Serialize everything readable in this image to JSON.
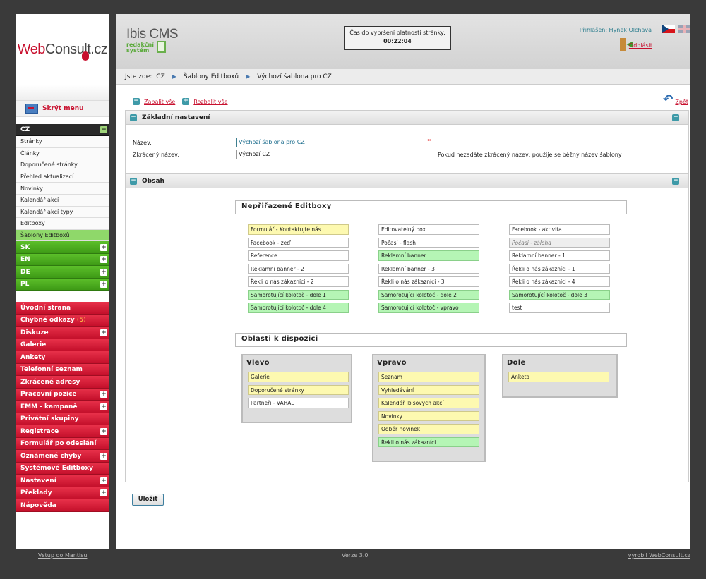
{
  "brand": {
    "logo_web": "Web",
    "logo_consult": "Consult.cz",
    "cms_title": "Ibis CMS",
    "cms_sub1": "redakční",
    "cms_sub2": "systém"
  },
  "sidebar": {
    "hide_menu": "Skrýt menu",
    "cz_label": "CZ",
    "cz_items": [
      "Stránky",
      "Články",
      "Doporučené stránky",
      "Přehled aktualizací",
      "Novinky",
      "Kalendář akcí",
      "Kalendář akcí typy",
      "Editboxy",
      "Šablony Editboxů"
    ],
    "langs": [
      "SK",
      "EN",
      "DE",
      "PL"
    ],
    "red_items": [
      {
        "label": "Úvodní strana",
        "plus": false
      },
      {
        "label": "Chybné odkazy",
        "badge": "(5)",
        "plus": false
      },
      {
        "label": "Diskuze",
        "plus": true
      },
      {
        "label": "Galerie",
        "plus": false
      },
      {
        "label": "Ankety",
        "plus": false
      },
      {
        "label": "Telefonní seznam",
        "plus": false
      },
      {
        "label": "Zkrácené adresy",
        "plus": false
      },
      {
        "label": "Pracovní pozice",
        "plus": true
      },
      {
        "label": "EMM - kampaně",
        "plus": true
      },
      {
        "label": "Privátní skupiny",
        "plus": false
      },
      {
        "label": "Registrace",
        "plus": true
      },
      {
        "label": "Formulář po odeslání",
        "plus": false
      },
      {
        "label": "Oznámené chyby",
        "plus": true
      },
      {
        "label": "Systémové Editboxy",
        "plus": false
      },
      {
        "label": "Nastavení",
        "plus": true
      },
      {
        "label": "Překlady",
        "plus": true
      },
      {
        "label": "Nápověda",
        "plus": false
      }
    ]
  },
  "header": {
    "timer_label": "Čas do vypršení platnosti stránky:",
    "timer_value": "00:22:04",
    "user": "Přihlášen: Hynek Olchava",
    "logout": "Odhlásit"
  },
  "breadcrumb": {
    "prefix": "Jste zde:",
    "items": [
      "CZ",
      "Šablony Editboxů",
      "Výchozí šablona pro CZ"
    ]
  },
  "toolbar": {
    "collapse_all": "Zabalit vše",
    "expand_all": "Rozbalit vše",
    "back": "Zpět"
  },
  "basic": {
    "title": "Základní nastavení",
    "name_label": "Název:",
    "name_value": "Výchozí šablona pro CZ",
    "short_label": "Zkrácený název:",
    "short_value": "Výchozí CZ",
    "short_hint": "Pokud nezadáte zkrácený název, použije se běžný název šablony"
  },
  "content": {
    "title": "Obsah",
    "unassigned_title": "Nepřiřazené Editboxy",
    "unassigned": [
      [
        {
          "t": "Formulář - Kontaktujte nás",
          "c": "y"
        },
        {
          "t": "Facebook - zeď",
          "c": ""
        },
        {
          "t": "Reference",
          "c": ""
        },
        {
          "t": "Reklamní banner - 2",
          "c": ""
        },
        {
          "t": "Řekli o nás zákazníci - 2",
          "c": ""
        },
        {
          "t": "Samorotující kolotoč - dole 1",
          "c": "g"
        },
        {
          "t": "Samorotující kolotoč - dole 4",
          "c": "g"
        }
      ],
      [
        {
          "t": "Editovatelný box",
          "c": ""
        },
        {
          "t": "Počasí - flash",
          "c": ""
        },
        {
          "t": "Reklamní banner",
          "c": "g"
        },
        {
          "t": "Reklamní banner - 3",
          "c": ""
        },
        {
          "t": "Řekli o nás zákazníci - 3",
          "c": ""
        },
        {
          "t": "Samorotující kolotoč - dole 2",
          "c": "g"
        },
        {
          "t": "Samorotující kolotoč - vpravo",
          "c": "g"
        }
      ],
      [
        {
          "t": "Facebook - aktivita",
          "c": ""
        },
        {
          "t": "Počasí - záloha",
          "c": "i"
        },
        {
          "t": "Reklamní banner - 1",
          "c": ""
        },
        {
          "t": "Řekli o nás zákazníci - 1",
          "c": ""
        },
        {
          "t": "Řekli o nás zákazníci - 4",
          "c": ""
        },
        {
          "t": "Samorotující kolotoč - dole 3",
          "c": "g"
        },
        {
          "t": "test",
          "c": ""
        }
      ]
    ],
    "areas_title": "Oblasti k dispozici",
    "areas": [
      {
        "name": "Vlevo",
        "items": [
          {
            "t": "Galerie",
            "c": "y"
          },
          {
            "t": "Doporučené stránky",
            "c": "y"
          },
          {
            "t": "Partneři - VAHAL",
            "c": ""
          }
        ]
      },
      {
        "name": "Vpravo",
        "items": [
          {
            "t": "Seznam",
            "c": "y"
          },
          {
            "t": "Vyhledávání",
            "c": "y"
          },
          {
            "t": "Kalendář Ibisových akcí",
            "c": "y"
          },
          {
            "t": "Novinky",
            "c": "y"
          },
          {
            "t": "Odběr novinek",
            "c": "y"
          },
          {
            "t": "Řekli o nás zákazníci",
            "c": "g"
          }
        ]
      },
      {
        "name": "Dole",
        "items": [
          {
            "t": "Anketa",
            "c": "y"
          }
        ]
      }
    ]
  },
  "save_label": "Uložit",
  "footer": {
    "left": "Vstup do Mantisu",
    "center": "Verze 3.0",
    "right": "vyrobil WebConsult.cz"
  }
}
